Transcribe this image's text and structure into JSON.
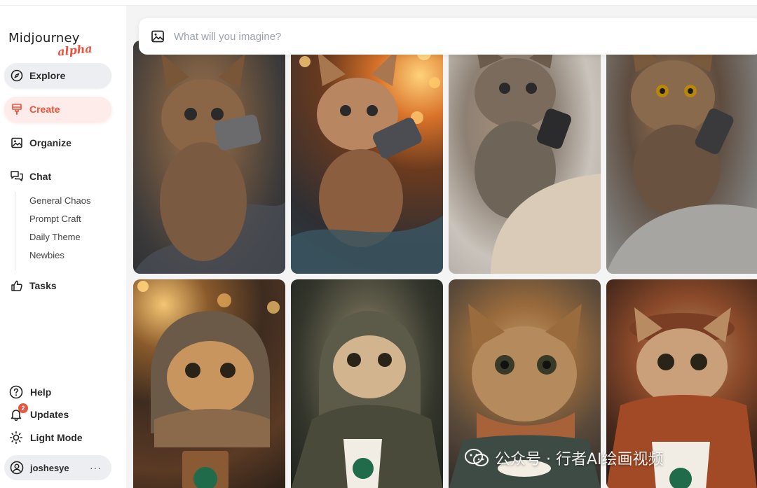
{
  "brand": {
    "name": "Midjourney",
    "tag": "alpha",
    "accent": "#e8543d"
  },
  "nav": {
    "explore": "Explore",
    "create": "Create",
    "organize": "Organize",
    "chat": "Chat",
    "chat_channels": [
      "General Chaos",
      "Prompt Craft",
      "Daily Theme",
      "Newbies"
    ],
    "tasks": "Tasks"
  },
  "footer_nav": {
    "help": "Help",
    "updates": "Updates",
    "updates_badge": "2",
    "light_mode": "Light Mode",
    "username": "joshesye",
    "more": "···"
  },
  "search": {
    "placeholder": "What will you imagine?",
    "value": "",
    "icon": "image-icon"
  },
  "gallery": {
    "rows": 2,
    "columns": 4,
    "images": [
      "kitten-holding-phone-on-blanket",
      "kitten-with-phone-bokeh-lights",
      "kitten-with-phone-on-knit-blanket",
      "tabby-kitten-with-phone-on-knit",
      "kitten-in-knit-hood-with-coffee",
      "kitten-in-hoodie-with-coffee-cup",
      "kitten-with-scarf-and-coffee",
      "kitten-in-beret-and-scarf-with-coffee"
    ]
  },
  "watermark": {
    "text": "公众号 · 行者AI绘画视频",
    "icon": "wechat-icon"
  }
}
